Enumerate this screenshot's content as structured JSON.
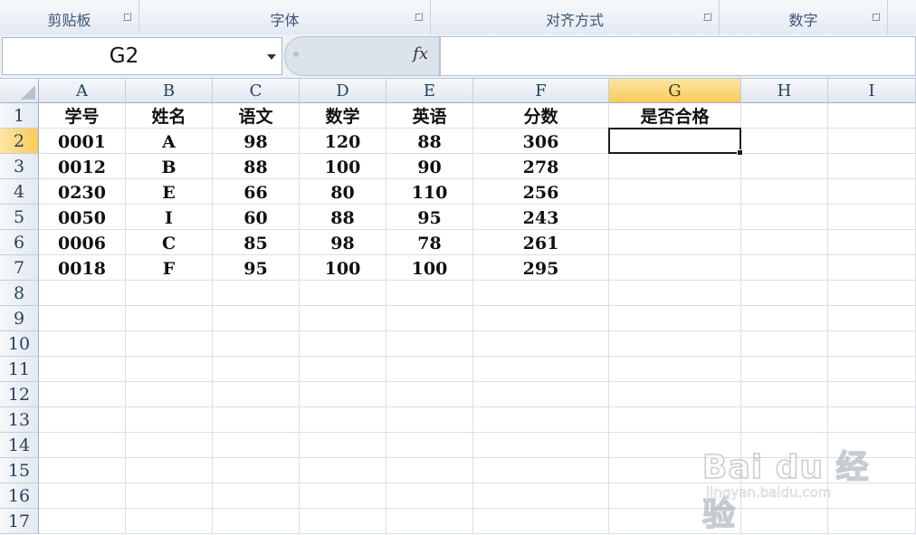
{
  "ribbon": {
    "groups": [
      {
        "label": "剪贴板"
      },
      {
        "label": "字体"
      },
      {
        "label": "对齐方式"
      },
      {
        "label": "数字"
      }
    ]
  },
  "formula_bar": {
    "name_box": "G2",
    "fx_label": "fx",
    "formula": ""
  },
  "sheet": {
    "columns": [
      "A",
      "B",
      "C",
      "D",
      "E",
      "F",
      "G",
      "H",
      "I"
    ],
    "rows": [
      "1",
      "2",
      "3",
      "4",
      "5",
      "6",
      "7",
      "8",
      "9",
      "10",
      "11",
      "12",
      "13",
      "14",
      "15",
      "16",
      "17"
    ],
    "selected_cell": "G2",
    "cells": [
      [
        "学号",
        "姓名",
        "语文",
        "数学",
        "英语",
        "分数",
        "是否合格",
        "",
        ""
      ],
      [
        "0001",
        "A",
        "98",
        "120",
        "88",
        "306",
        "",
        "",
        ""
      ],
      [
        "0012",
        "B",
        "88",
        "100",
        "90",
        "278",
        "",
        "",
        ""
      ],
      [
        "0230",
        "E",
        "66",
        "80",
        "110",
        "256",
        "",
        "",
        ""
      ],
      [
        "0050",
        "I",
        "60",
        "88",
        "95",
        "243",
        "",
        "",
        ""
      ],
      [
        "0006",
        "C",
        "85",
        "98",
        "78",
        "261",
        "",
        "",
        ""
      ],
      [
        "0018",
        "F",
        "95",
        "100",
        "100",
        "295",
        "",
        "",
        ""
      ]
    ]
  },
  "watermark": {
    "brand": "Bai du 经验",
    "url": "jingyan.baidu.com"
  }
}
